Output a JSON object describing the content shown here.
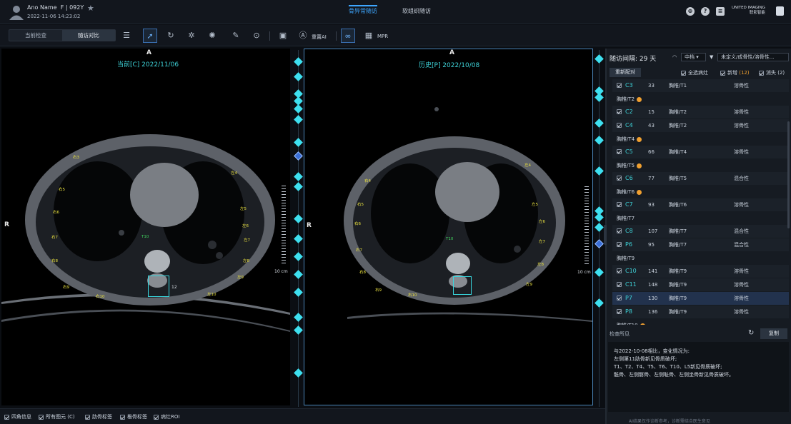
{
  "header": {
    "patient_name": "Ano Name",
    "patient_info": "F | 092Y",
    "study_datetime": "2022-11-06 14:23:02",
    "tabs": [
      {
        "label": "骨异常随访",
        "active": true
      },
      {
        "label": "软组织随访",
        "active": false
      }
    ],
    "brand_line1": "UNITED IMAGING",
    "brand_line2": "联影智能"
  },
  "toolbar": {
    "mode_current": "当前检查",
    "mode_compare": "随访对比",
    "reset_ai_label": "重置AI",
    "mpr_label": "MPR"
  },
  "viewer_current": {
    "orientation_top": "A",
    "orientation_left": "R",
    "title": "当前[C] 2022/11/06",
    "ruler_label": "10 cm",
    "vertebra_label": "T10",
    "roi_number": "12",
    "ribs": [
      "右3",
      "右5",
      "右6",
      "右7",
      "右8",
      "右9",
      "右10",
      "左4",
      "左5",
      "左6",
      "左7",
      "左8",
      "左9",
      "左10"
    ]
  },
  "viewer_prior": {
    "orientation_top": "A",
    "orientation_left": "R",
    "title": "历史[P] 2022/10/08",
    "ruler_label": "10 cm",
    "vertebra_label": "T10",
    "ribs": [
      "右4",
      "右5",
      "右6",
      "右7",
      "右8",
      "右9",
      "右10",
      "左4",
      "左5",
      "左6",
      "左7",
      "左8",
      "左9"
    ]
  },
  "bottom_options": [
    "四角信息",
    "所有图元 (C)",
    "肋骨标签",
    "椎骨标签",
    "病灶ROI"
  ],
  "panel": {
    "followup_interval": "随访间隔: 29 天",
    "filter_level": "中档",
    "filter_type": "未定义/成骨性/溶骨性...",
    "rematch_label": "重新配对",
    "select_all_label": "全选病灶",
    "new_label": "新增",
    "new_count": "(12)",
    "vanished_label": "消失",
    "vanished_count": "(2)",
    "rows": [
      {
        "kind": "row",
        "id": "C3",
        "num": "33",
        "pos": "胸椎/T1",
        "type": "溶骨性"
      },
      {
        "kind": "group",
        "label": "胸椎/T2",
        "dot": true
      },
      {
        "kind": "row",
        "id": "C2",
        "num": "15",
        "pos": "胸椎/T2",
        "type": "溶骨性"
      },
      {
        "kind": "row",
        "id": "C4",
        "num": "43",
        "pos": "胸椎/T2",
        "type": "溶骨性"
      },
      {
        "kind": "group",
        "label": "胸椎/T4",
        "dot": true
      },
      {
        "kind": "row",
        "id": "C5",
        "num": "66",
        "pos": "胸椎/T4",
        "type": "溶骨性"
      },
      {
        "kind": "group",
        "label": "胸椎/T5",
        "dot": true
      },
      {
        "kind": "row",
        "id": "C6",
        "num": "77",
        "pos": "胸椎/T5",
        "type": "混合性"
      },
      {
        "kind": "group",
        "label": "胸椎/T6",
        "dot": true
      },
      {
        "kind": "row",
        "id": "C7",
        "num": "93",
        "pos": "胸椎/T6",
        "type": "溶骨性"
      },
      {
        "kind": "group",
        "label": "胸椎/T7",
        "dot": false
      },
      {
        "kind": "row",
        "id": "C8",
        "num": "107",
        "pos": "胸椎/T7",
        "type": "混合性"
      },
      {
        "kind": "row",
        "id": "P6",
        "num": "95",
        "pos": "胸椎/T7",
        "type": "混合性"
      },
      {
        "kind": "group",
        "label": "胸椎/T9",
        "dot": false
      },
      {
        "kind": "row",
        "id": "C10",
        "num": "141",
        "pos": "胸椎/T9",
        "type": "溶骨性"
      },
      {
        "kind": "row",
        "id": "C11",
        "num": "148",
        "pos": "胸椎/T9",
        "type": "溶骨性"
      },
      {
        "kind": "row",
        "id": "P7",
        "num": "130",
        "pos": "胸椎/T9",
        "type": "溶骨性",
        "selected": true
      },
      {
        "kind": "row",
        "id": "P8",
        "num": "136",
        "pos": "胸椎/T9",
        "type": "溶骨性"
      },
      {
        "kind": "group",
        "label": "胸椎/T10",
        "dot": true
      }
    ],
    "conclusion_title": "检查所见",
    "copy_label": "复制",
    "conclusion_lines": [
      "与2022-10-08相比，变化情况为:",
      "左侧第11肋骨新见骨质破坏;",
      "T1、T2、T4、T5、T6、T10、L5新见骨质破坏;",
      "骶骨、左侧髂骨、左侧耻骨、左侧坐骨新见骨质破坏。"
    ],
    "disclaimer": "AI结果仅作诊断参考，诊断需结合医生意见"
  },
  "colors": {
    "accent": "#3ea6ff",
    "lesion_id": "#3ed2d8",
    "timeline": "#3ee0f0",
    "rib_label": "#e8e040"
  },
  "icons": [
    "user-icon",
    "star-icon",
    "globe-icon",
    "help-icon",
    "message-icon",
    "list-icon",
    "pointer-icon",
    "rotate-icon",
    "brightness-icon",
    "contrast-icon",
    "pen-icon",
    "zoom-icon",
    "layers-icon",
    "ai-icon",
    "link-icon",
    "mpr-icon",
    "refresh-icon"
  ]
}
